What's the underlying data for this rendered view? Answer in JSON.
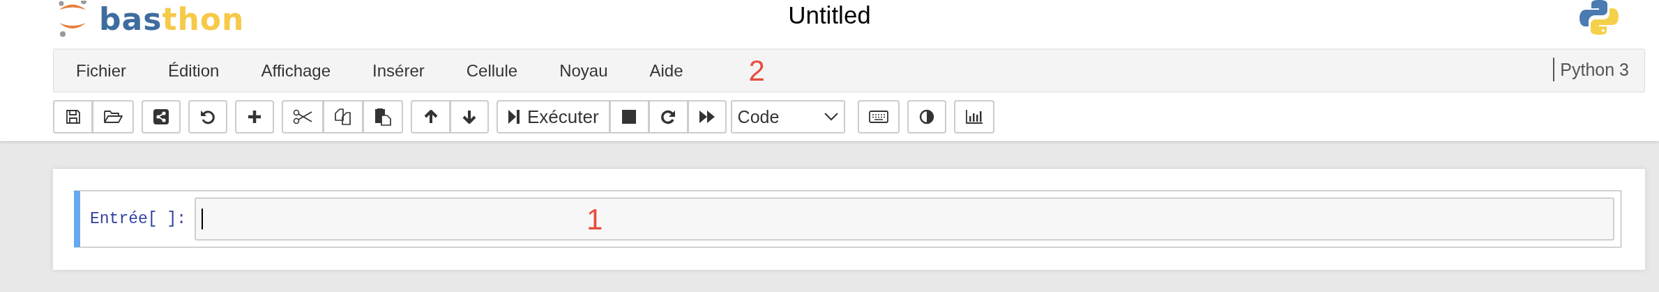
{
  "header": {
    "logo_parts": [
      "bas",
      "thon"
    ],
    "title": "Untitled"
  },
  "menubar": {
    "items": [
      {
        "label": "Fichier"
      },
      {
        "label": "Édition"
      },
      {
        "label": "Affichage"
      },
      {
        "label": "Insérer"
      },
      {
        "label": "Cellule"
      },
      {
        "label": "Noyau"
      },
      {
        "label": "Aide"
      }
    ],
    "annotation": "2",
    "kernel": "Python 3"
  },
  "toolbar": {
    "run_label": "Exécuter",
    "cell_type": "Code"
  },
  "cell": {
    "prompt": "Entrée[ ]:",
    "selected": true,
    "annotation": "1"
  }
}
